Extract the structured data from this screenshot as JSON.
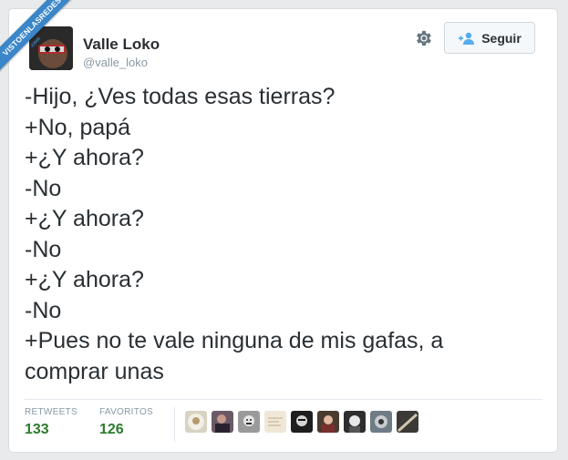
{
  "watermark": {
    "text": "VISTOENLASREDES",
    "sub": ".com"
  },
  "user": {
    "name": "Valle Loko",
    "handle": "@valle_loko"
  },
  "actions": {
    "follow_label": "Seguir",
    "follow_icon": "add-user-icon",
    "settings_icon": "gear-icon"
  },
  "tweet": {
    "lines": [
      "-Hijo, ¿Ves todas esas tierras?",
      "+No, papá",
      "+¿Y ahora?",
      "-No",
      "+¿Y ahora?",
      "-No",
      "+¿Y ahora?",
      "-No",
      "+Pues no te vale ninguna de mis gafas, a",
      "comprar unas"
    ]
  },
  "stats": {
    "retweets_label": "RETWEETS",
    "retweets": "133",
    "favorites_label": "FAVORITOS",
    "favorites": "126"
  },
  "colors": {
    "accent": "#55acee",
    "count": "#2d7a2d",
    "ribbon": "#3b86c8"
  }
}
